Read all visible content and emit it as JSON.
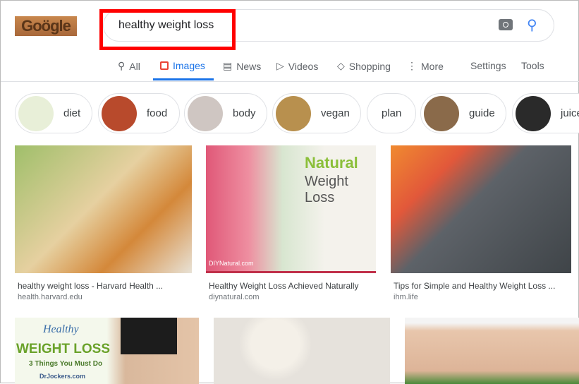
{
  "logo": {
    "text": "Goögle"
  },
  "search": {
    "query": "healthy weight loss",
    "camera_icon": "camera-icon",
    "search_icon": "search-icon"
  },
  "tabs": [
    {
      "label": "All",
      "icon": "search-icon"
    },
    {
      "label": "Images",
      "icon": "image-icon",
      "active": true
    },
    {
      "label": "News",
      "icon": "news-icon"
    },
    {
      "label": "Videos",
      "icon": "play-icon"
    },
    {
      "label": "Shopping",
      "icon": "tag-icon"
    },
    {
      "label": "More",
      "icon": "more-vert-icon"
    }
  ],
  "settings": "Settings",
  "tools": "Tools",
  "chips": [
    "diet",
    "food",
    "body",
    "vegan",
    "plan",
    "guide",
    "juice"
  ],
  "results": [
    {
      "title": "healthy weight loss - Harvard Health ...",
      "source": "health.harvard.edu"
    },
    {
      "title": "Healthy Weight Loss Achieved Naturally",
      "source": "diynatural.com",
      "overlay": [
        "Natural",
        "Weight Loss",
        "DIYNatural.com"
      ]
    },
    {
      "title": "Tips for Simple and Healthy Weight Loss ...",
      "source": "ihm.life"
    },
    {
      "overlay": [
        "Healthy",
        "WEIGHT LOSS",
        "3 Things You Must Do",
        "DrJockers.com"
      ]
    },
    {},
    {}
  ],
  "colors": {
    "accent": "#1a73e8",
    "highlight": "#ff0000"
  }
}
